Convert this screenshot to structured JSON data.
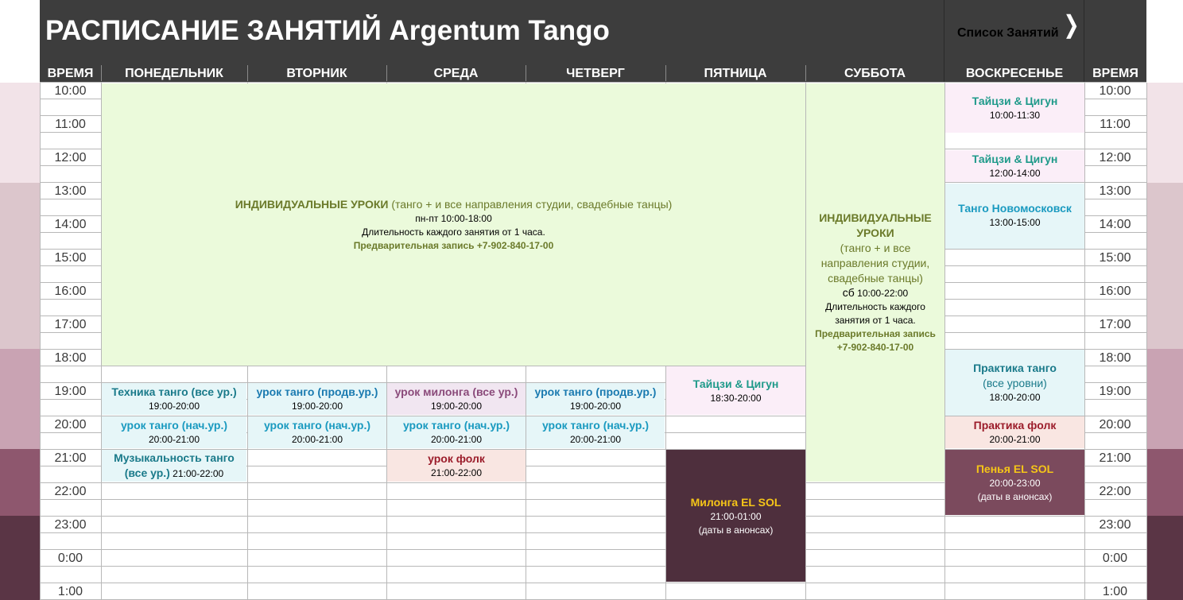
{
  "header": {
    "title": "РАСПИСАНИЕ ЗАНЯТИЙ Argentum Tango",
    "list_link": "Список Занятий",
    "chevron": "❭"
  },
  "columns": {
    "time_left": "ВРЕМЯ",
    "mon": "ПОНЕДЕЛЬНИК",
    "tue": "ВТОРНИК",
    "wed": "СРЕДА",
    "thu": "ЧЕТВЕРГ",
    "fri": "ПЯТНИЦА",
    "sat": "СУББОТА",
    "sun": "ВОСКРЕСЕНЬЕ",
    "time_right": "ВРЕМЯ"
  },
  "times": [
    "10:00",
    "11:00",
    "12:00",
    "13:00",
    "14:00",
    "15:00",
    "16:00",
    "17:00",
    "18:00",
    "19:00",
    "20:00",
    "21:00",
    "22:00",
    "23:00",
    "0:00",
    "1:00"
  ],
  "colors": {
    "header": "#3d3d3d",
    "individual_bg": "#ebfadb",
    "individual_text": "#6b7a2a",
    "light_blue_bg": "#e6f6f8",
    "pink_bg": "#fbeef8",
    "peach_bg": "#f9e6e2",
    "dark_milonga": "#4e2f3d",
    "band_1": "#f2e3e8",
    "band_2": "#dcc6cc",
    "band_3": "#c9a3b3",
    "band_4": "#8e576e",
    "band_5": "#5a3545"
  },
  "individual_weekday": {
    "title": "ИНДИВИДУАЛЬНЫЕ УРОКИ",
    "subtitle": " (танго + и все направления студии, свадебные танцы)",
    "hours": "пн-пт 10:00-18:00",
    "duration": "Длительность каждого занятия от 1 часа.",
    "booking": "Предварительная запись +7-902-840-17-00"
  },
  "individual_sat": {
    "title": "ИНДИВИДУАЛЬНЫЕ УРОКИ",
    "subtitle": "(танго + и все направления студии, свадебные танцы)",
    "hours_prefix": "сб",
    "hours": " 10:00-22:00",
    "duration": "Длительность каждого занятия от 1 часа.",
    "booking": "Предварительная запись +7-902-840-17-00"
  },
  "sunday": [
    {
      "title": "Тайцзи & Цигун",
      "time": "10:00-11:30"
    },
    {
      "title": "Тайцзи & Цигун",
      "time": "12:00-14:00"
    },
    {
      "title": "Танго Новомосковск",
      "time": "13:00-15:00"
    },
    {
      "title": "Практика танго",
      "title2": "(все уровни)",
      "time": "18:00-20:00"
    },
    {
      "title": "Практика фолк",
      "time": "20:00-21:00"
    },
    {
      "title": "Пенья EL SOL",
      "time": "20:00-23:00",
      "note": "(даты в анонсах)"
    }
  ],
  "monday": [
    {
      "title": "Техника танго (все ур.)",
      "time": "19:00-20:00"
    },
    {
      "title": "урок танго (нач.ур.)",
      "time": "20:00-21:00"
    },
    {
      "title": "Музыкальность танго",
      "title2": "(все ур.)",
      "time": " 21:00-22:00"
    }
  ],
  "tuesday": [
    {
      "title": "урок танго (продв.ур.)",
      "time": "19:00-20:00"
    },
    {
      "title": "урок танго (нач.ур.)",
      "time": "20:00-21:00"
    }
  ],
  "wednesday": [
    {
      "title": "урок милонга (все ур.)",
      "time": "19:00-20:00"
    },
    {
      "title": "урок танго (нач.ур.)",
      "time": "20:00-21:00"
    },
    {
      "title": "урок фолк",
      "time": "21:00-22:00"
    }
  ],
  "thursday": [
    {
      "title": "урок танго (продв.ур.)",
      "time": "19:00-20:00"
    },
    {
      "title": "урок танго (нач.ур.)",
      "time": "20:00-21:00"
    }
  ],
  "friday": [
    {
      "title": "Тайцзи & Цигун",
      "time": "18:30-20:00"
    },
    {
      "title": "Милонга EL SOL",
      "time": "21:00-01:00",
      "note": "(даты в анонсах)"
    }
  ]
}
